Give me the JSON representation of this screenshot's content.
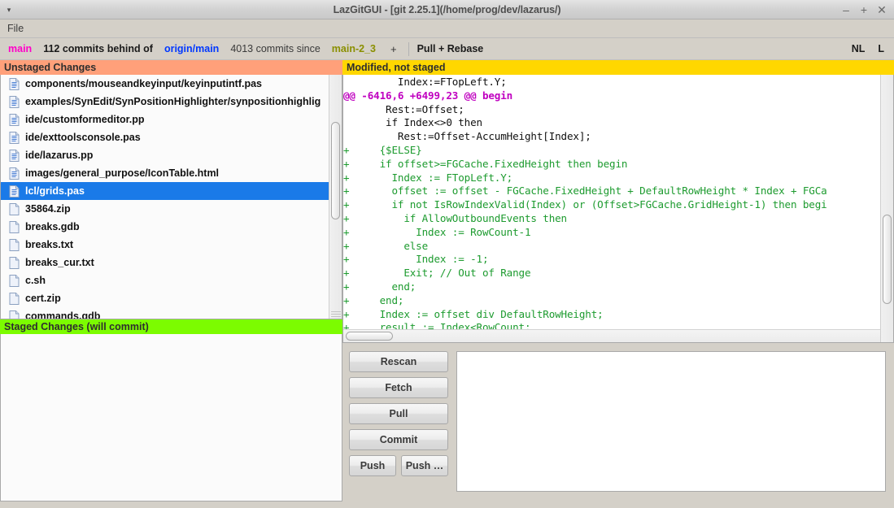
{
  "window": {
    "title": "LazGitGUI - [git 2.25.1](/home/prog/dev/lazarus/)",
    "menu_arrow": "▾",
    "controls": {
      "minimize": "–",
      "maximize": "+",
      "close": "✕"
    }
  },
  "menubar": {
    "items": [
      {
        "label": "File"
      }
    ]
  },
  "branchbar": {
    "branch": "main",
    "behind_text": "112 commits behind of",
    "remote": "origin/main",
    "since_text": "4013 commits since",
    "tag": "main-2_3",
    "plus": "+",
    "action": "Pull + Rebase",
    "right": [
      {
        "label": "NL"
      },
      {
        "label": "L"
      }
    ]
  },
  "colors": {
    "unstaged_header_bg": "#ffa07a",
    "staged_header_bg": "#7cfc00",
    "modified_header_bg": "#ffd700",
    "branch_name": "#ff00c8",
    "remote_name": "#0038ff",
    "tag_name": "#8a8f00",
    "selection": "#1a7ae8",
    "diff_add": "#1d9b2f",
    "diff_hunk": "#c000c0"
  },
  "panels": {
    "unstaged_header": "Unstaged Changes",
    "staged_header": "Staged Changes (will commit)",
    "modified_header": "Modified, not staged"
  },
  "unstaged_files": [
    {
      "name": "components/mouseandkeyinput/keyinputintf.pas",
      "icon": "text-file-icon",
      "selected": false
    },
    {
      "name": "examples/SynEdit/SynPositionHighlighter/synpositionhighlig",
      "icon": "text-file-icon",
      "selected": false
    },
    {
      "name": "ide/customformeditor.pp",
      "icon": "text-file-icon",
      "selected": false
    },
    {
      "name": "ide/exttoolsconsole.pas",
      "icon": "text-file-icon",
      "selected": false
    },
    {
      "name": "ide/lazarus.pp",
      "icon": "text-file-icon",
      "selected": false
    },
    {
      "name": "images/general_purpose/IconTable.html",
      "icon": "text-file-icon",
      "selected": false
    },
    {
      "name": "lcl/grids.pas",
      "icon": "text-file-icon",
      "selected": true
    },
    {
      "name": "35864.zip",
      "icon": "blank-file-icon",
      "selected": false
    },
    {
      "name": "breaks.gdb",
      "icon": "blank-file-icon",
      "selected": false
    },
    {
      "name": "breaks.txt",
      "icon": "blank-file-icon",
      "selected": false
    },
    {
      "name": "breaks_cur.txt",
      "icon": "blank-file-icon",
      "selected": false
    },
    {
      "name": "c.sh",
      "icon": "blank-file-icon",
      "selected": false
    },
    {
      "name": "cert.zip",
      "icon": "blank-file-icon",
      "selected": false
    },
    {
      "name": "commands.gdb",
      "icon": "blank-file-icon",
      "selected": false
    }
  ],
  "staged_files": [],
  "diff_lines": [
    {
      "type": "ctx",
      "text": "         Index:=FTopLeft.Y;"
    },
    {
      "type": "hunk",
      "text": "@@ -6416,6 +6499,23 @@ begin"
    },
    {
      "type": "ctx",
      "text": "       Rest:=Offset;"
    },
    {
      "type": "ctx",
      "text": "       if Index<>0 then"
    },
    {
      "type": "ctx",
      "text": "         Rest:=Offset-AccumHeight[Index];"
    },
    {
      "type": "add",
      "text": "+     {$ELSE}"
    },
    {
      "type": "add",
      "text": "+     if offset>=FGCache.FixedHeight then begin"
    },
    {
      "type": "add",
      "text": "+       Index := FTopLeft.Y;"
    },
    {
      "type": "add",
      "text": "+       offset := offset - FGCache.FixedHeight + DefaultRowHeight * Index + FGCa"
    },
    {
      "type": "add",
      "text": "+       if not IsRowIndexValid(Index) or (Offset>FGCache.GridHeight-1) then begi"
    },
    {
      "type": "add",
      "text": "+         if AllowOutboundEvents then"
    },
    {
      "type": "add",
      "text": "+           Index := RowCount-1"
    },
    {
      "type": "add",
      "text": "+         else"
    },
    {
      "type": "add",
      "text": "+           Index := -1;"
    },
    {
      "type": "add",
      "text": "+         Exit; // Out of Range"
    },
    {
      "type": "add",
      "text": "+       end;"
    },
    {
      "type": "add",
      "text": "+     end;"
    },
    {
      "type": "add",
      "text": "+     Index := offset div DefaultRowHeight;"
    },
    {
      "type": "add",
      "text": "+     result := Index<RowCount;"
    }
  ],
  "buttons": {
    "rescan": "Rescan",
    "fetch": "Fetch",
    "pull": "Pull",
    "commit": "Commit",
    "push": "Push",
    "push_more": "Push …"
  },
  "commit_message": {
    "value": "",
    "placeholder": ""
  }
}
